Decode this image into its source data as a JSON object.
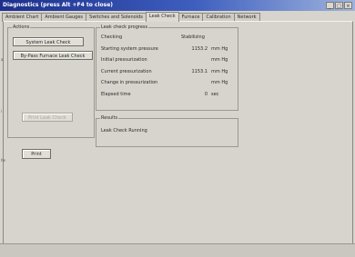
{
  "window": {
    "title": "Diagnostics  (press Alt +F4 to close)",
    "controls": [
      "_",
      "□",
      "×"
    ]
  },
  "tabs": [
    {
      "label": "Ambient Chart",
      "active": false
    },
    {
      "label": "Ambient Gauges",
      "active": false
    },
    {
      "label": "Switches and Solenoids",
      "active": false
    },
    {
      "label": "Leak Check",
      "active": true
    },
    {
      "label": "Furnace",
      "active": false
    },
    {
      "label": "Calibration",
      "active": false
    },
    {
      "label": "Network",
      "active": false
    }
  ],
  "actions": {
    "legend": "Actions",
    "system_button": "System Leak Check",
    "bypass_button": "By-Pass Furnace Leak Check",
    "print_leak_button": "Print Leak Check"
  },
  "progress": {
    "legend": "Leak check progress",
    "checking_label": "Checking",
    "checking_value": "Stabilizing",
    "rows": [
      {
        "label": "Starting system pressure",
        "value": "1153.2",
        "unit": "mm Hg"
      },
      {
        "label": "Initial pressurization",
        "value": "",
        "unit": "mm Hg"
      },
      {
        "label": "Current pressurization",
        "value": "1153.1",
        "unit": "mm Hg"
      },
      {
        "label": "Change in pressurization",
        "value": "",
        "unit": "mm Hg"
      },
      {
        "label": "Elapsed time",
        "value": "0",
        "unit": "sec"
      }
    ]
  },
  "results": {
    "legend": "Results",
    "text": "Leak Check Running"
  },
  "print_button": "Print",
  "side_markers": [
    "a",
    "i",
    "he"
  ]
}
